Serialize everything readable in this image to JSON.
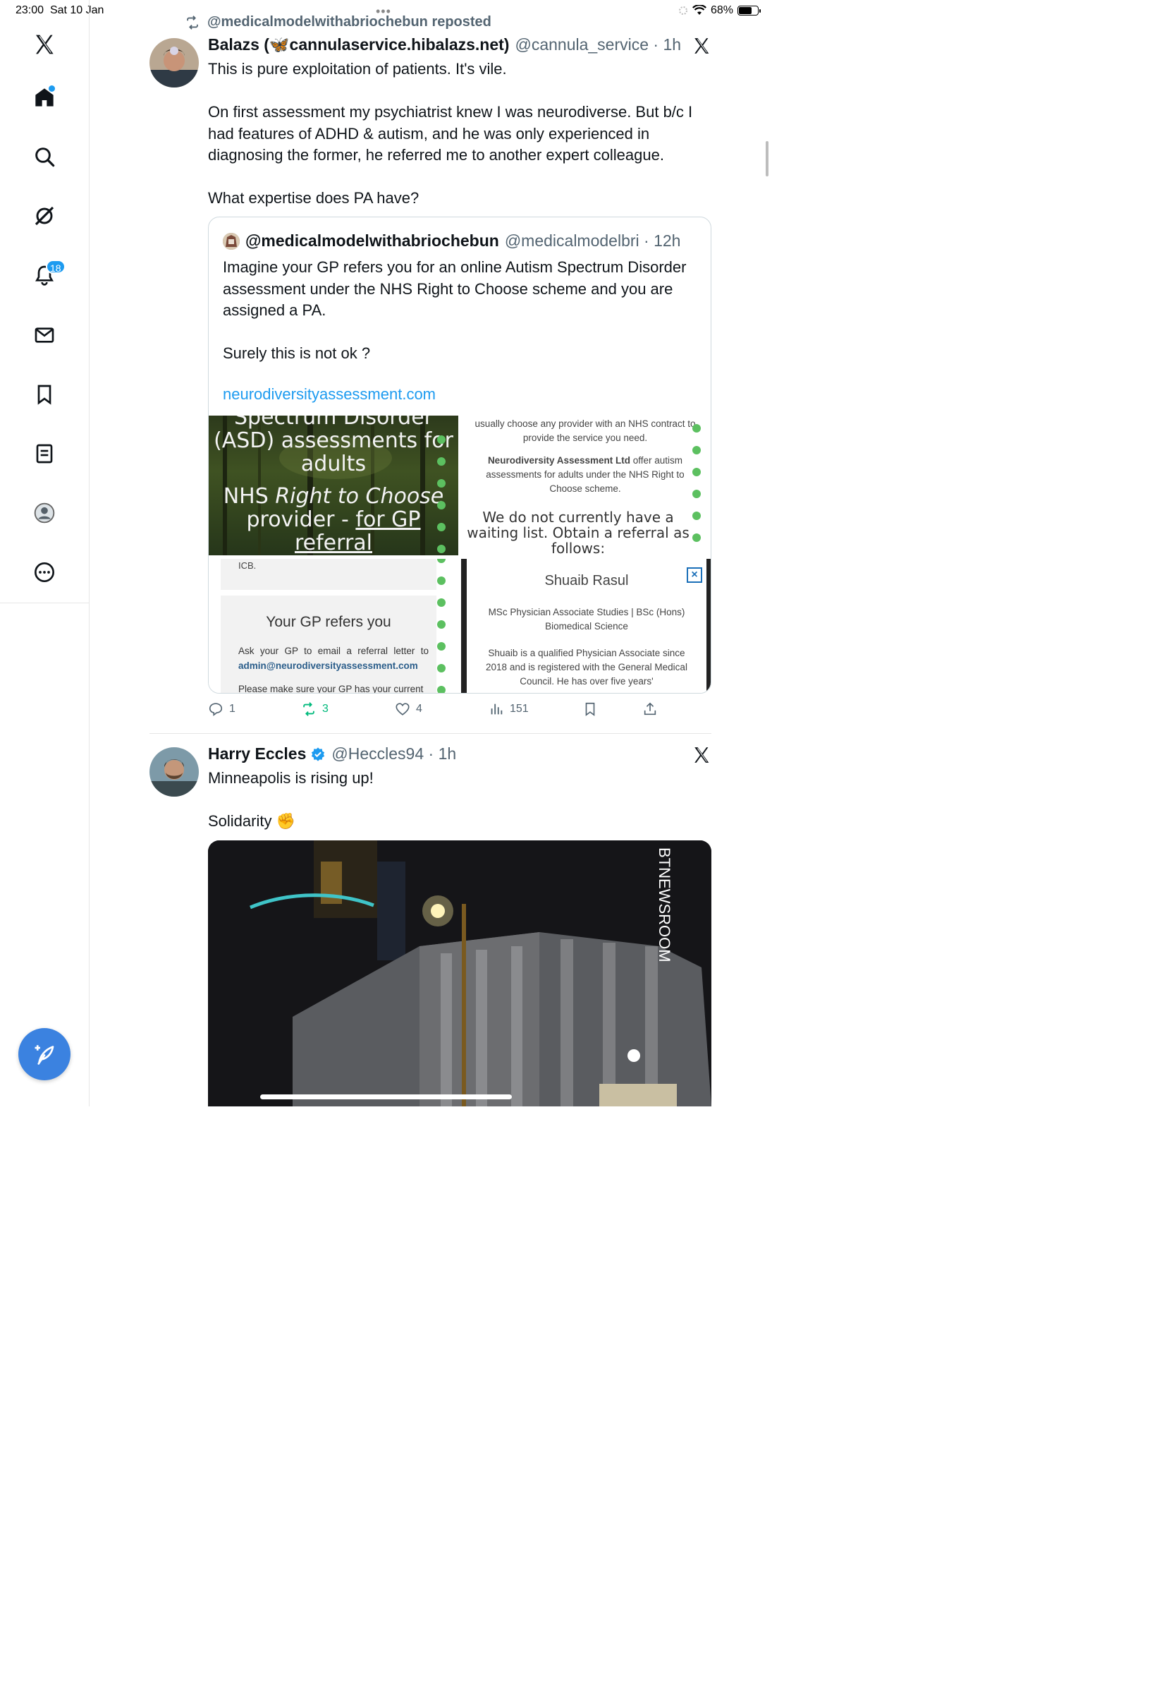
{
  "status": {
    "time": "23:00",
    "date": "Sat 10 Jan",
    "battery": "68%"
  },
  "sidebar": {
    "items": [
      {
        "icon": "x-logo-icon"
      },
      {
        "icon": "home-icon"
      },
      {
        "icon": "search-icon"
      },
      {
        "icon": "grok-icon"
      },
      {
        "icon": "bell-icon",
        "badge": "18"
      },
      {
        "icon": "mail-icon"
      },
      {
        "icon": "bookmark-icon"
      },
      {
        "icon": "list-icon"
      },
      {
        "icon": "profile-icon"
      },
      {
        "icon": "more-icon"
      }
    ],
    "compose_icon": "compose-feather-icon"
  },
  "tweet1": {
    "repost_label": "@medicalmodelwithabriochebun reposted",
    "name": "Balazs (🦋cannulaservice.hibalazs.net)",
    "handle": "@cannula_service · 1h",
    "text": "This is pure exploitation of patients. It's vile.\n\nOn first assessment my psychiatrist knew I was neurodiverse. But b/c I had features of ADHD & autism, and he was only experienced in diagnosing the former, he referred me to another expert colleague.\n\nWhat expertise does PA have?",
    "quote": {
      "name": "@medicalmodelwithabriochebun",
      "handle": "@medicalmodelbri · 12h",
      "text": "Imagine your GP refers you for an online Autism Spectrum Disorder assessment under the NHS Right to Choose scheme and you are assigned a PA.\n\nSurely this is not ok ?",
      "link": "neurodiversityassessment.com",
      "media1": {
        "line1": "Spectrum Disorder (ASD) assessments for adults",
        "line2_a": "NHS ",
        "line2_b": "Right to Choose",
        "line2_c": " provider - ",
        "line2_d": "for GP referral"
      },
      "media2": {
        "text1": "usually choose any provider with an NHS contract to provide the service you need.",
        "text2_bold": "Neurodiversity Assessment Ltd",
        "text2_rest": " offer autism assessments for adults under the NHS Right to Choose scheme.",
        "big": "We do not currently have a waiting list. Obtain a referral as follows:"
      },
      "media3": {
        "icb": "ICB.",
        "title": "Your GP refers you",
        "text": "Ask your GP to email a referral letter to ",
        "email": "admin@neurodiversityassessment.com",
        "text2": "Please make sure your GP has your current"
      },
      "media4": {
        "name": "Shuaib Rasul",
        "quals": "MSc Physician Associate Studies | BSc (Hons) Biomedical Science",
        "bio": "Shuaib is a qualified Physician Associate since 2018 and is registered with the General Medical Council. He has over five years'"
      }
    },
    "actions": {
      "replies": "1",
      "reposts": "3",
      "likes": "4",
      "views": "151"
    }
  },
  "tweet2": {
    "name": "Harry Eccles",
    "handle": "@Heccles94 · 1h",
    "text": "Minneapolis is rising up!\n\nSolidarity ✊",
    "video_watermark": "BTNEWSROOM"
  },
  "colors": {
    "accent": "#1d9bf0",
    "repost_green": "#00ba7c",
    "muted": "#536471"
  }
}
